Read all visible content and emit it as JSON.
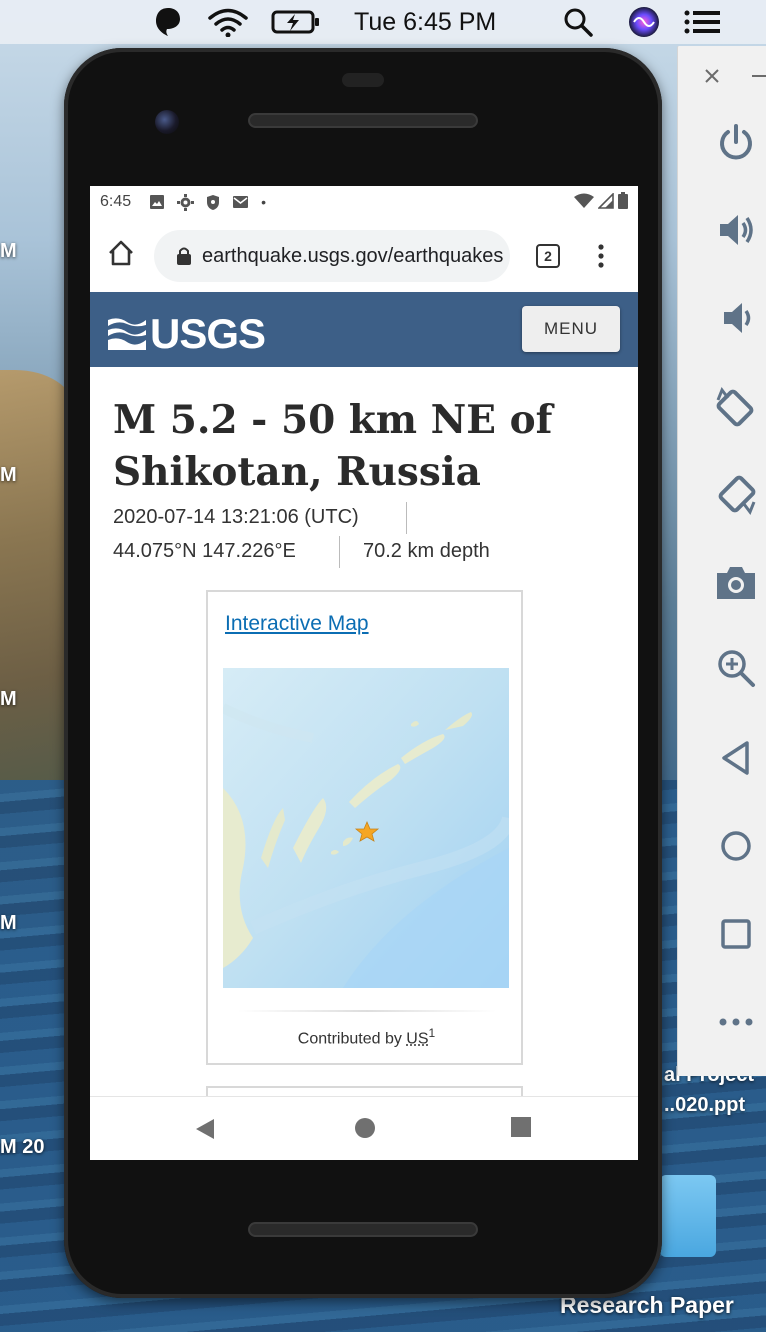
{
  "menubar": {
    "time": "Tue 6:45 PM"
  },
  "desktop": {
    "side_labels": [
      "M",
      "M",
      "M",
      "M",
      "M"
    ],
    "bottom_left_label": "M   20",
    "right_snippets": [
      "al Project",
      "..020.ppt"
    ],
    "folder_label": "Research Paper"
  },
  "emulator_panel": {
    "controls": [
      "close-icon",
      "minimize-icon",
      "power-icon",
      "volume-up-icon",
      "volume-down-icon",
      "rotate-left-icon",
      "rotate-right-icon",
      "camera-icon",
      "zoom-icon",
      "back-icon",
      "home-icon",
      "overview-icon",
      "more-icon"
    ]
  },
  "phone": {
    "status_bar": {
      "time": "6:45",
      "dot": "•"
    },
    "browser": {
      "url": "earthquake.usgs.gov/earthquakes",
      "tab_count": "2"
    },
    "site_header": {
      "logo_text": "USGS",
      "menu_label": "MENU"
    },
    "event": {
      "title": "M 5.2 - 50 km NE of Shikotan, Russia",
      "datetime": "2020-07-14 13:21:06 (UTC)",
      "coordinates": "44.075°N 147.226°E",
      "depth": "70.2 km depth"
    },
    "map_card": {
      "link_label": "Interactive Map",
      "contributed_prefix": "Contributed by",
      "network": "US",
      "footnote": "1"
    }
  },
  "colors": {
    "usgs_blue": "#3d5f87",
    "link_blue": "#0b6db3",
    "epicenter_star": "#f5a623"
  }
}
